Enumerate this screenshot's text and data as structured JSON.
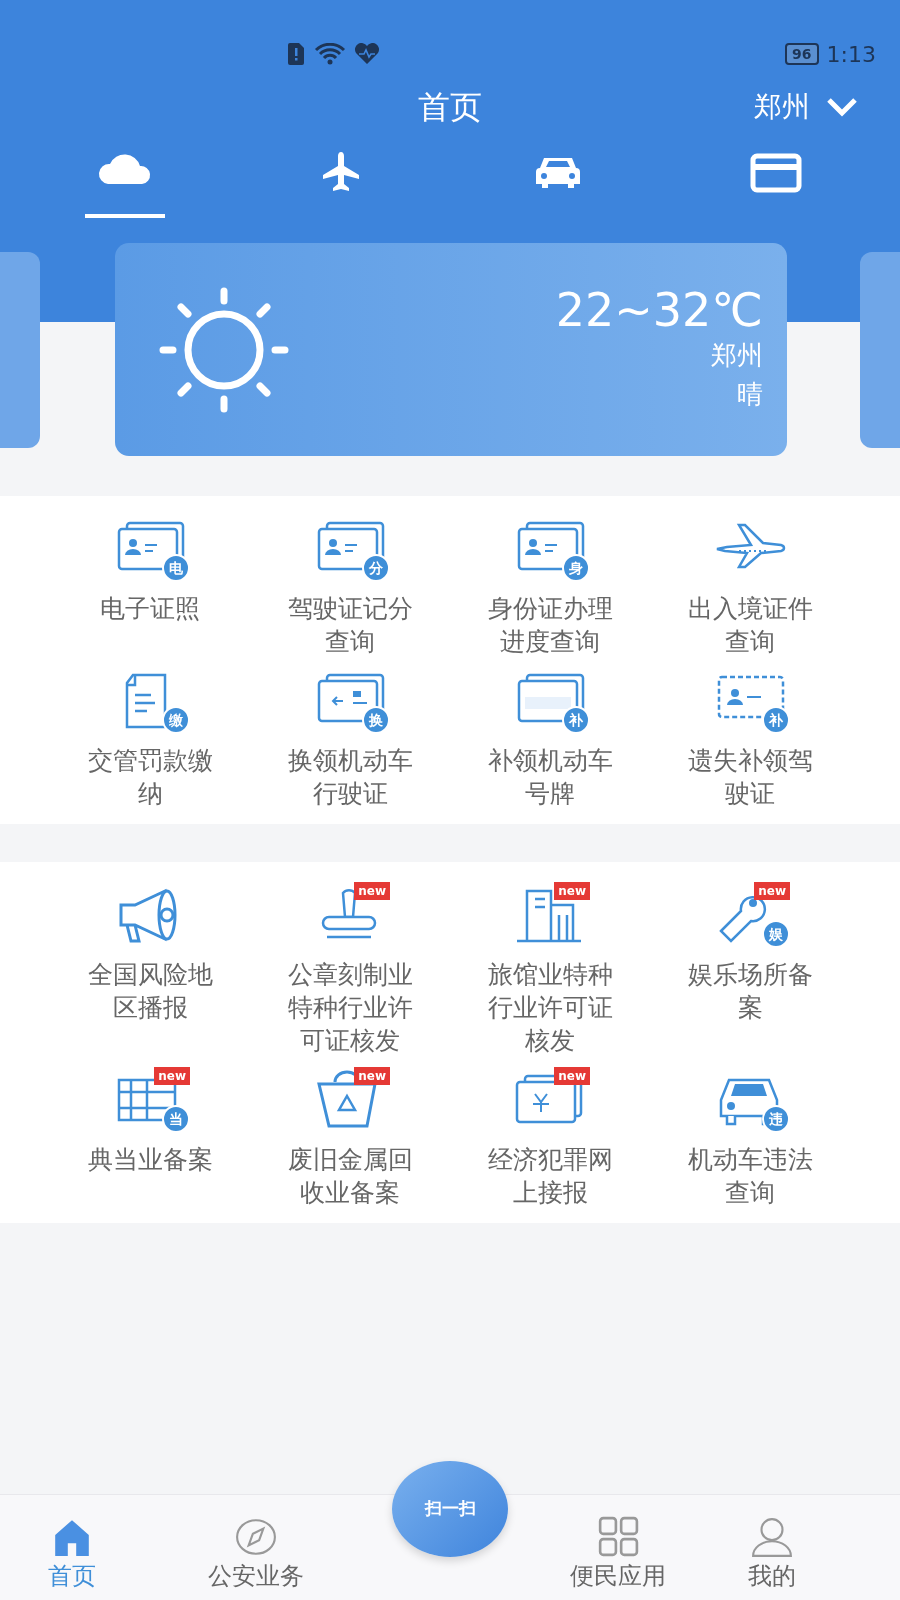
{
  "status_bar": {
    "battery": "96",
    "time": "1:13"
  },
  "header": {
    "title": "首页",
    "city": "郑州"
  },
  "tabs": [
    {
      "selected": true
    },
    {
      "selected": false
    },
    {
      "selected": false
    },
    {
      "selected": false
    }
  ],
  "weather": {
    "temperature": "22~32℃",
    "city": "郑州",
    "condition": "晴"
  },
  "sections": [
    {
      "items": [
        {
          "label": "电子证照",
          "badge": "电"
        },
        {
          "label": "驾驶证记分查询",
          "badge": "分"
        },
        {
          "label": "身份证办理进度查询",
          "badge": "身"
        },
        {
          "label": "出入境证件查询"
        },
        {
          "label": "交管罚款缴纳",
          "badge": "缴"
        },
        {
          "label": "换领机动车行驶证",
          "badge": "换"
        },
        {
          "label": "补领机动车号牌",
          "badge": "补"
        },
        {
          "label": "遗失补领驾驶证",
          "badge": "补"
        }
      ]
    },
    {
      "items": [
        {
          "label": "全国风险地区播报"
        },
        {
          "label": "公章刻制业特种行业许可证核发",
          "new_tag": "new"
        },
        {
          "label": "旅馆业特种行业许可证核发",
          "new_tag": "new"
        },
        {
          "label": "娱乐场所备案",
          "badge": "娱",
          "new_tag": "new"
        },
        {
          "label": "典当业备案",
          "badge": "当",
          "new_tag": "new"
        },
        {
          "label": "废旧金属回收业备案",
          "new_tag": "new"
        },
        {
          "label": "经济犯罪网上接报",
          "new_tag": "new"
        },
        {
          "label": "机动车违法查询",
          "badge": "违"
        }
      ]
    }
  ],
  "scan_button": {
    "label": "扫一扫"
  },
  "bottom_nav": [
    {
      "label": "首页",
      "selected": true
    },
    {
      "label": "公安业务",
      "selected": false
    },
    {
      "label": "便民应用",
      "selected": false
    },
    {
      "label": "我的",
      "selected": false
    }
  ]
}
